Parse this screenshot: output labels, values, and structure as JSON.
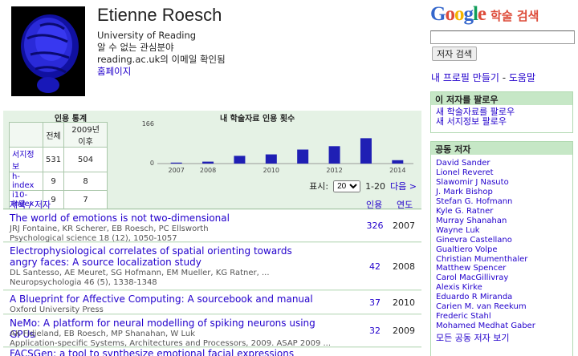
{
  "profile": {
    "name": "Etienne Roesch",
    "affiliation": "University of Reading",
    "interests": "알 수 없는 관심분야",
    "email_verified": "reading.ac.uk의 이메일 확인됨",
    "homepage": "홈페이지"
  },
  "search": {
    "brand": "Google",
    "scholar_label": "학술 검색",
    "button": "저자 검색",
    "input_value": ""
  },
  "links": {
    "create_profile": "내 프로필 만들기",
    "separator": " - ",
    "help": "도움말"
  },
  "follow": {
    "header": "이 저자를 팔로우",
    "new_articles": "새 학술자료를 팔로우",
    "new_citations": "새 서지정보 팔로우"
  },
  "coauthors": {
    "header": "공동 저자",
    "names": [
      "David Sander",
      "Lionel Reveret",
      "Slawomir J Nasuto",
      "J. Mark Bishop",
      "Stefan G. Hofmann",
      "Kyle G. Ratner",
      "Murray Shanahan",
      "Wayne Luk",
      "Ginevra Castellano",
      "Gualtiero Volpe",
      "Christian Mumenthaler",
      "Matthew Spencer",
      "Carol MacGillivray",
      "Alexis Kirke",
      "Eduardo R Miranda",
      "Carien M. van Reekum",
      "Frederic Stahl",
      "Mohamed Medhat Gaber"
    ],
    "all_link": "모든 공동 저자 보기"
  },
  "stats": {
    "title": "인용 통계",
    "col_all": "전체",
    "col_since": "2009년 이후",
    "rows": [
      {
        "label": "서지정보",
        "all": "531",
        "since": "504"
      },
      {
        "label": "h-index",
        "all": "9",
        "since": "8"
      },
      {
        "label": "i10-index",
        "all": "9",
        "since": "7"
      }
    ]
  },
  "chart_data": {
    "type": "bar",
    "title": "내 학술자료 인용 횟수",
    "categories": [
      "2007",
      "2008",
      "2009",
      "2010",
      "2011",
      "2012",
      "2013",
      "2014"
    ],
    "tick_labels": [
      "2007",
      "2008",
      "2010",
      "2012",
      "2014"
    ],
    "values": [
      4,
      8,
      32,
      38,
      58,
      72,
      105,
      14
    ],
    "ylim": [
      0,
      166
    ],
    "y_ticks": [
      "166",
      "0"
    ],
    "bar_color": "#1f1fb4",
    "xlabel": "",
    "ylabel": ""
  },
  "controls": {
    "show_label": "표시:",
    "per_page": "20",
    "range": "1-20",
    "next": "다음 >"
  },
  "list_header": {
    "title_author": "제목 / 저자",
    "cited": "인용",
    "year": "연도"
  },
  "publications": [
    {
      "title": "The world of emotions is not two-dimensional",
      "authors": "JRJ Fontaine, KR Scherer, EB Roesch, PC Ellsworth",
      "venue": "Psychological science 18 (12), 1050-1057",
      "cites": "326",
      "year": "2007"
    },
    {
      "title": "Electrophysiological correlates of spatial orienting towards angry faces: A source localization study",
      "authors": "DL Santesso, AE Meuret, SG Hofmann, EM Mueller, KG Ratner, ...",
      "venue": "Neuropsychologia 46 (5), 1338-1348",
      "cites": "42",
      "year": "2008"
    },
    {
      "title": "A Blueprint for Affective Computing: A sourcebook and manual",
      "authors": "Oxford University Press",
      "venue": "",
      "cites": "37",
      "year": "2010"
    },
    {
      "title": "NeMo: A platform for neural modelling of spiking neurons using GPUs",
      "authors": "AK Fidjeland, EB Roesch, MP Shanahan, W Luk",
      "venue": "Application-specific Systems, Architectures and Processors, 2009. ASAP 2009 ...",
      "cites": "32",
      "year": "2009"
    },
    {
      "title": "FACSGen: a tool to synthesize emotional facial expressions through systematic",
      "authors": "",
      "venue": "",
      "cites": "",
      "year": ""
    }
  ]
}
